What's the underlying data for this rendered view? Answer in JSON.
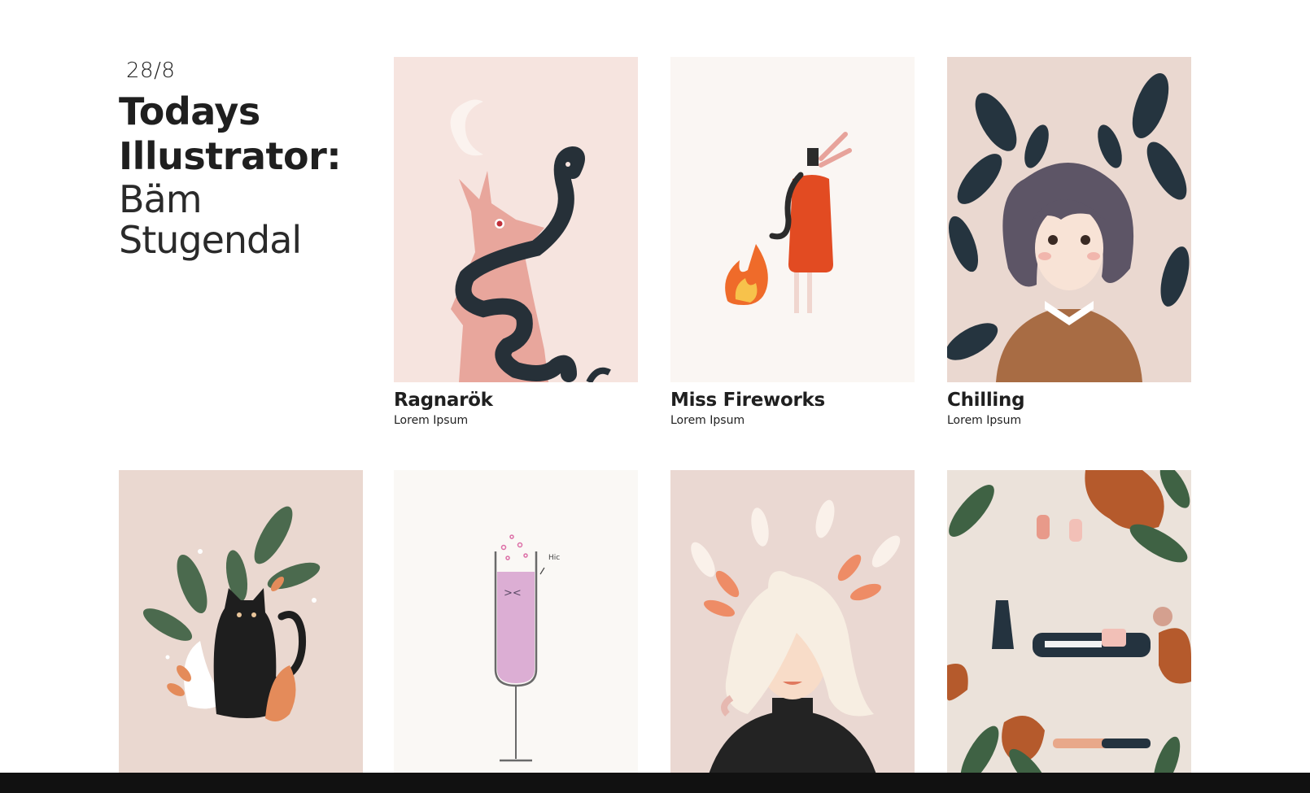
{
  "intro": {
    "date": "28/8",
    "headline_line1": "Todays",
    "headline_line2": "Illustrator:",
    "artist_name": "Bäm Stugendal"
  },
  "gallery": [
    {
      "title": "Ragnarök",
      "subtitle": "Lorem Ipsum",
      "artwork_icon": "dragon-snake-illustration",
      "background": "#f6e4df"
    },
    {
      "title": "Miss Fireworks",
      "subtitle": "Lorem Ipsum",
      "artwork_icon": "fire-extinguisher-illustration",
      "background": "#faf6f3"
    },
    {
      "title": "Chilling",
      "subtitle": "Lorem Ipsum",
      "artwork_icon": "girl-with-leaves-illustration",
      "background": "#ead8d0"
    },
    {
      "title": "",
      "subtitle": "",
      "artwork_icon": "black-cat-illustration",
      "background": "#ead8d0"
    },
    {
      "title": "",
      "subtitle": "",
      "artwork_icon": "champagne-glass-illustration",
      "background": "#faf8f5"
    },
    {
      "title": "",
      "subtitle": "",
      "artwork_icon": "blonde-woman-illustration",
      "background": "#ead8d2"
    },
    {
      "title": "",
      "subtitle": "",
      "artwork_icon": "couples-leisure-illustration",
      "background": "#ebe2da"
    }
  ],
  "artwork_text": {
    "hic": "Hic"
  }
}
